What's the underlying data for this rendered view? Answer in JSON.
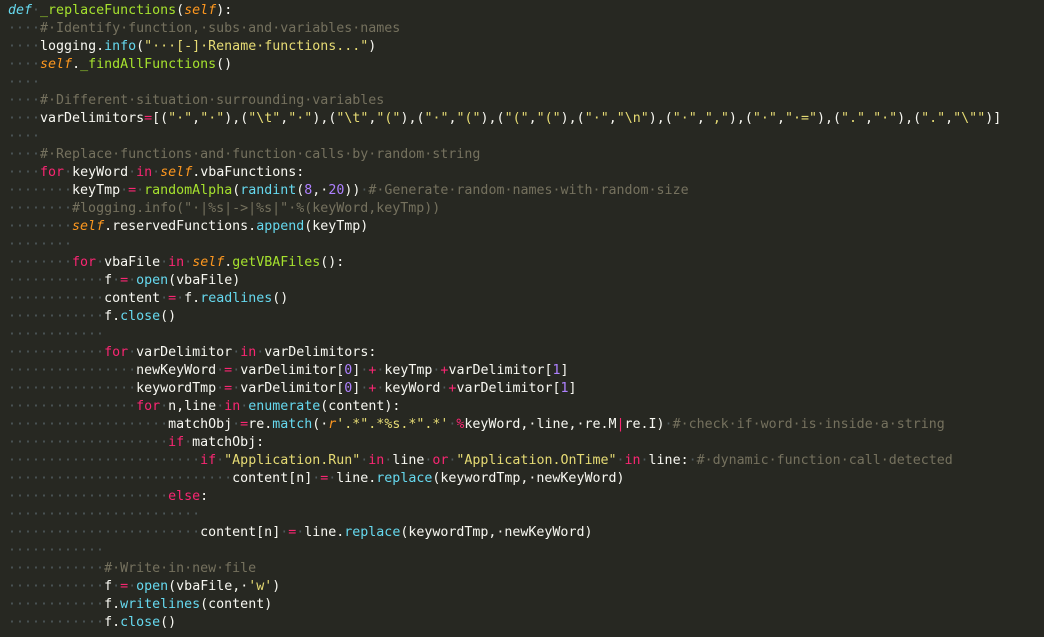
{
  "editor": {
    "theme_colors": {
      "background": "#272822",
      "text": "#f8f8f2",
      "keyword": "#f92672",
      "function_name": "#a6e22e",
      "self": "#fd971f",
      "string": "#e6db74",
      "number": "#ae81ff",
      "comment": "#75715e",
      "builtin_call": "#66d9ef",
      "whitespace_dots": "#4f5a5d"
    },
    "lines": [
      [
        [
          "def",
          "def"
        ],
        [
          "ws",
          "·"
        ],
        [
          "fn",
          "_replaceFunctions"
        ],
        [
          "text",
          "("
        ],
        [
          "self",
          "self"
        ],
        [
          "text",
          "):"
        ]
      ],
      [
        [
          "ws",
          "····"
        ],
        [
          "com",
          "#·Identify·function,·subs·and·variables·names"
        ]
      ],
      [
        [
          "ws",
          "····"
        ],
        [
          "text",
          "logging."
        ],
        [
          "call",
          "info"
        ],
        [
          "text",
          "("
        ],
        [
          "str",
          "\"···[-]·Rename·functions...\""
        ],
        [
          "text",
          ")"
        ]
      ],
      [
        [
          "ws",
          "····"
        ],
        [
          "self",
          "self"
        ],
        [
          "text",
          "."
        ],
        [
          "fn",
          "_findAllFunctions"
        ],
        [
          "text",
          "()"
        ]
      ],
      [
        [
          "ws",
          "····"
        ]
      ],
      [
        [
          "ws",
          "····"
        ],
        [
          "com",
          "#·Different·situation·surrounding·variables"
        ]
      ],
      [
        [
          "ws",
          "····"
        ],
        [
          "text",
          "varDelimitors"
        ],
        [
          "kw",
          "="
        ],
        [
          "text",
          "[("
        ],
        [
          "str",
          "\"·\""
        ],
        [
          "text",
          ","
        ],
        [
          "str",
          "\"·\""
        ],
        [
          "text",
          "),("
        ],
        [
          "str",
          "\"\\t\""
        ],
        [
          "text",
          ","
        ],
        [
          "str",
          "\"·\""
        ],
        [
          "text",
          "),("
        ],
        [
          "str",
          "\"\\t\""
        ],
        [
          "text",
          ","
        ],
        [
          "str",
          "\"(\""
        ],
        [
          "text",
          "),("
        ],
        [
          "str",
          "\"·\""
        ],
        [
          "text",
          ","
        ],
        [
          "str",
          "\"(\""
        ],
        [
          "text",
          "),("
        ],
        [
          "str",
          "\"(\""
        ],
        [
          "text",
          ","
        ],
        [
          "str",
          "\"(\""
        ],
        [
          "text",
          "),("
        ],
        [
          "str",
          "\"·\""
        ],
        [
          "text",
          ","
        ],
        [
          "str",
          "\"\\n\""
        ],
        [
          "text",
          "),("
        ],
        [
          "str",
          "\"·\""
        ],
        [
          "text",
          ","
        ],
        [
          "str",
          "\",\""
        ],
        [
          "text",
          "),("
        ],
        [
          "str",
          "\"·\""
        ],
        [
          "text",
          ","
        ],
        [
          "str",
          "\"·=\""
        ],
        [
          "text",
          "),("
        ],
        [
          "str",
          "\".\""
        ],
        [
          "text",
          ","
        ],
        [
          "str",
          "\"·\""
        ],
        [
          "text",
          "),("
        ],
        [
          "str",
          "\".\""
        ],
        [
          "text",
          ","
        ],
        [
          "str",
          "\"\\\"\""
        ],
        [
          "text",
          ")]"
        ]
      ],
      [
        [
          "ws",
          "····"
        ]
      ],
      [
        [
          "ws",
          "····"
        ],
        [
          "com",
          "#·Replace·functions·and·function·calls·by·random·string"
        ]
      ],
      [
        [
          "ws",
          "····"
        ],
        [
          "kw",
          "for"
        ],
        [
          "ws",
          "·"
        ],
        [
          "text",
          "keyWord"
        ],
        [
          "ws",
          "·"
        ],
        [
          "kw",
          "in"
        ],
        [
          "ws",
          "·"
        ],
        [
          "self",
          "self"
        ],
        [
          "text",
          ".vbaFunctions:"
        ]
      ],
      [
        [
          "ws",
          "········"
        ],
        [
          "text",
          "keyTmp"
        ],
        [
          "ws",
          "·"
        ],
        [
          "kw",
          "="
        ],
        [
          "ws",
          "·"
        ],
        [
          "fn",
          "randomAlpha"
        ],
        [
          "text",
          "("
        ],
        [
          "call",
          "randint"
        ],
        [
          "text",
          "("
        ],
        [
          "num",
          "8"
        ],
        [
          "text",
          ",·"
        ],
        [
          "num",
          "20"
        ],
        [
          "text",
          "))"
        ],
        [
          "ws",
          "·"
        ],
        [
          "com",
          "#·Generate·random·names·with·random·size"
        ]
      ],
      [
        [
          "ws",
          "········"
        ],
        [
          "com",
          "#logging.info(\"·|%s|->|%s|\"·%(keyWord,keyTmp))"
        ]
      ],
      [
        [
          "ws",
          "········"
        ],
        [
          "self",
          "self"
        ],
        [
          "text",
          ".reservedFunctions."
        ],
        [
          "call",
          "append"
        ],
        [
          "text",
          "(keyTmp)"
        ]
      ],
      [
        [
          "ws",
          "········"
        ]
      ],
      [
        [
          "ws",
          "········"
        ],
        [
          "kw",
          "for"
        ],
        [
          "ws",
          "·"
        ],
        [
          "text",
          "vbaFile"
        ],
        [
          "ws",
          "·"
        ],
        [
          "kw",
          "in"
        ],
        [
          "ws",
          "·"
        ],
        [
          "self",
          "self"
        ],
        [
          "text",
          "."
        ],
        [
          "fn",
          "getVBAFiles"
        ],
        [
          "text",
          "():"
        ]
      ],
      [
        [
          "ws",
          "············"
        ],
        [
          "text",
          "f"
        ],
        [
          "ws",
          "·"
        ],
        [
          "kw",
          "="
        ],
        [
          "ws",
          "·"
        ],
        [
          "call",
          "open"
        ],
        [
          "text",
          "(vbaFile)"
        ]
      ],
      [
        [
          "ws",
          "············"
        ],
        [
          "text",
          "content"
        ],
        [
          "ws",
          "·"
        ],
        [
          "kw",
          "="
        ],
        [
          "ws",
          "·"
        ],
        [
          "text",
          "f."
        ],
        [
          "call",
          "readlines"
        ],
        [
          "text",
          "()"
        ]
      ],
      [
        [
          "ws",
          "············"
        ],
        [
          "text",
          "f."
        ],
        [
          "call",
          "close"
        ],
        [
          "text",
          "()"
        ]
      ],
      [
        [
          "ws",
          "············"
        ]
      ],
      [
        [
          "ws",
          "············"
        ],
        [
          "kw",
          "for"
        ],
        [
          "ws",
          "·"
        ],
        [
          "text",
          "varDelimitor"
        ],
        [
          "ws",
          "·"
        ],
        [
          "kw",
          "in"
        ],
        [
          "ws",
          "·"
        ],
        [
          "text",
          "varDelimitors:"
        ]
      ],
      [
        [
          "ws",
          "················"
        ],
        [
          "text",
          "newKeyWord"
        ],
        [
          "ws",
          "·"
        ],
        [
          "kw",
          "="
        ],
        [
          "ws",
          "·"
        ],
        [
          "text",
          "varDelimitor["
        ],
        [
          "num",
          "0"
        ],
        [
          "text",
          "]"
        ],
        [
          "ws",
          "·"
        ],
        [
          "kw",
          "+"
        ],
        [
          "ws",
          "·"
        ],
        [
          "text",
          "keyTmp"
        ],
        [
          "ws",
          "·"
        ],
        [
          "kw",
          "+"
        ],
        [
          "text",
          "varDelimitor["
        ],
        [
          "num",
          "1"
        ],
        [
          "text",
          "]"
        ]
      ],
      [
        [
          "ws",
          "················"
        ],
        [
          "text",
          "keywordTmp"
        ],
        [
          "ws",
          "·"
        ],
        [
          "kw",
          "="
        ],
        [
          "ws",
          "·"
        ],
        [
          "text",
          "varDelimitor["
        ],
        [
          "num",
          "0"
        ],
        [
          "text",
          "]"
        ],
        [
          "ws",
          "·"
        ],
        [
          "kw",
          "+"
        ],
        [
          "ws",
          "·"
        ],
        [
          "text",
          "keyWord"
        ],
        [
          "ws",
          "·"
        ],
        [
          "kw",
          "+"
        ],
        [
          "text",
          "varDelimitor["
        ],
        [
          "num",
          "1"
        ],
        [
          "text",
          "]"
        ]
      ],
      [
        [
          "ws",
          "················"
        ],
        [
          "kw",
          "for"
        ],
        [
          "ws",
          "·"
        ],
        [
          "text",
          "n,line"
        ],
        [
          "ws",
          "·"
        ],
        [
          "kw",
          "in"
        ],
        [
          "ws",
          "·"
        ],
        [
          "call",
          "enumerate"
        ],
        [
          "text",
          "(content):"
        ]
      ],
      [
        [
          "ws",
          "····················"
        ],
        [
          "text",
          "matchObj"
        ],
        [
          "ws",
          "·"
        ],
        [
          "kw",
          "="
        ],
        [
          "text",
          "re."
        ],
        [
          "call",
          "match"
        ],
        [
          "text",
          "(·"
        ],
        [
          "self",
          "r"
        ],
        [
          "str",
          "'.*\".*%s.*\".*'"
        ],
        [
          "ws",
          "·"
        ],
        [
          "kw",
          "%"
        ],
        [
          "text",
          "keyWord,·line,·re.M"
        ],
        [
          "kw",
          "|"
        ],
        [
          "text",
          "re.I)"
        ],
        [
          "ws",
          "·"
        ],
        [
          "com",
          "#·check·if·word·is·inside·a·string"
        ]
      ],
      [
        [
          "ws",
          "····················"
        ],
        [
          "kw",
          "if"
        ],
        [
          "ws",
          "·"
        ],
        [
          "text",
          "matchObj:"
        ]
      ],
      [
        [
          "ws",
          "························"
        ],
        [
          "kw",
          "if"
        ],
        [
          "ws",
          "·"
        ],
        [
          "str",
          "\"Application.Run\""
        ],
        [
          "ws",
          "·"
        ],
        [
          "kw",
          "in"
        ],
        [
          "ws",
          "·"
        ],
        [
          "text",
          "line"
        ],
        [
          "ws",
          "·"
        ],
        [
          "kw",
          "or"
        ],
        [
          "ws",
          "·"
        ],
        [
          "str",
          "\"Application.OnTime\""
        ],
        [
          "ws",
          "·"
        ],
        [
          "kw",
          "in"
        ],
        [
          "ws",
          "·"
        ],
        [
          "text",
          "line:"
        ],
        [
          "ws",
          "·"
        ],
        [
          "com",
          "#·dynamic·function·call·detected"
        ]
      ],
      [
        [
          "ws",
          "····························"
        ],
        [
          "text",
          "content[n]"
        ],
        [
          "ws",
          "·"
        ],
        [
          "kw",
          "="
        ],
        [
          "ws",
          "·"
        ],
        [
          "text",
          "line."
        ],
        [
          "call",
          "replace"
        ],
        [
          "text",
          "(keywordTmp,·newKeyWord)"
        ]
      ],
      [
        [
          "ws",
          "····················"
        ],
        [
          "kw",
          "else"
        ],
        [
          "text",
          ":"
        ]
      ],
      [
        [
          "ws",
          "························"
        ]
      ],
      [
        [
          "ws",
          "························"
        ],
        [
          "text",
          "content[n]"
        ],
        [
          "ws",
          "·"
        ],
        [
          "kw",
          "="
        ],
        [
          "ws",
          "·"
        ],
        [
          "text",
          "line."
        ],
        [
          "call",
          "replace"
        ],
        [
          "text",
          "(keywordTmp,·newKeyWord)"
        ]
      ],
      [
        [
          "ws",
          "············"
        ]
      ],
      [
        [
          "ws",
          "············"
        ],
        [
          "com",
          "#·Write·in·new·file"
        ]
      ],
      [
        [
          "ws",
          "············"
        ],
        [
          "text",
          "f"
        ],
        [
          "ws",
          "·"
        ],
        [
          "kw",
          "="
        ],
        [
          "ws",
          "·"
        ],
        [
          "call",
          "open"
        ],
        [
          "text",
          "(vbaFile,·"
        ],
        [
          "str",
          "'w'"
        ],
        [
          "text",
          ")"
        ]
      ],
      [
        [
          "ws",
          "············"
        ],
        [
          "text",
          "f."
        ],
        [
          "call",
          "writelines"
        ],
        [
          "text",
          "(content)"
        ]
      ],
      [
        [
          "ws",
          "············"
        ],
        [
          "text",
          "f."
        ],
        [
          "call",
          "close"
        ],
        [
          "text",
          "()"
        ]
      ]
    ]
  }
}
